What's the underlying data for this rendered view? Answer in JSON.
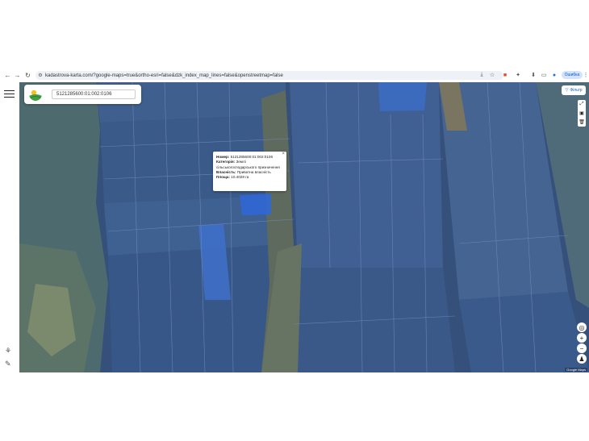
{
  "browser": {
    "url": "kadastrova-karta.com/?google-maps=true&ortho-esri=false&dzk_index_map_lines=false&openstreetmap=false",
    "profile_label": "Ошибка"
  },
  "map": {
    "search_value": "5121285600:01:002:0106",
    "filter_label": "Фільтр",
    "attribution": "Google Maps",
    "zoom_in": "+",
    "zoom_out": "−"
  },
  "popup": {
    "number_label": "Номер:",
    "number_value": "5121285600:01:002:0106",
    "category_label": "Категорія:",
    "category_value": "Землі сільськогосподарського призначення",
    "ownership_label": "Власність:",
    "ownership_value": "Приватна власність",
    "area_label": "Площа:",
    "area_value": "10.4028 га",
    "close": "×"
  },
  "icons": {
    "back": "arrow-left-icon",
    "forward": "arrow-right-icon",
    "reload": "reload-icon",
    "tune": "tune-icon"
  }
}
